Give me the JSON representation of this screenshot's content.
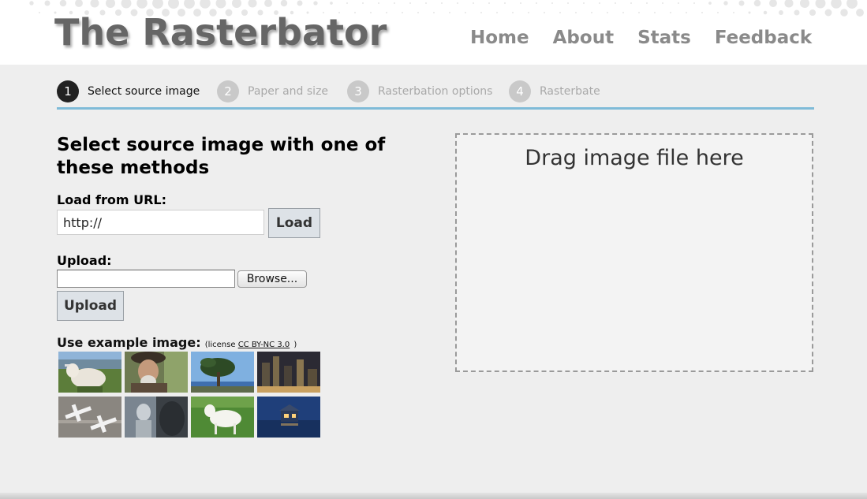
{
  "header": {
    "logo": "The Rasterbator",
    "nav": [
      "Home",
      "About",
      "Stats",
      "Feedback"
    ]
  },
  "steps": [
    {
      "num": "1",
      "label": "Select source image",
      "active": true
    },
    {
      "num": "2",
      "label": "Paper and size",
      "active": false
    },
    {
      "num": "3",
      "label": "Rasterbation options",
      "active": false
    },
    {
      "num": "4",
      "label": "Rasterbate",
      "active": false
    }
  ],
  "main": {
    "title": "Select source image with one of these methods",
    "url_label": "Load from URL:",
    "url_value": "http://",
    "load_button": "Load",
    "upload_label": "Upload:",
    "browse_button": "Browse...",
    "upload_button": "Upload",
    "example_label": "Use example image:",
    "license_prefix": "(license ",
    "license_link": "CC BY-NC 3.0",
    "license_suffix": ")"
  },
  "examples": [
    {
      "name": "cow"
    },
    {
      "name": "old man"
    },
    {
      "name": "tree"
    },
    {
      "name": "city at night"
    },
    {
      "name": "airplanes"
    },
    {
      "name": "statue"
    },
    {
      "name": "goat"
    },
    {
      "name": "house at dusk"
    }
  ],
  "drop": {
    "text": "Drag image file here"
  },
  "colors": {
    "accent_line": "#7fbbd8",
    "logo": "#666666",
    "nav": "#8a8a8a",
    "button_bg": "#dde2e7"
  }
}
